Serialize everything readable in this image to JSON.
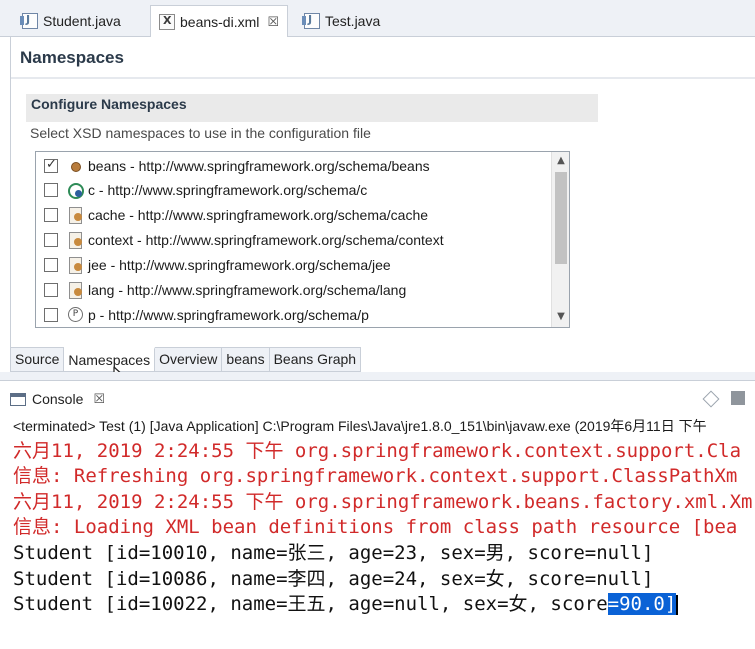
{
  "editor_tabs": [
    {
      "label": "Student.java",
      "icon": "java-file-icon"
    },
    {
      "label": "beans-di.xml",
      "icon": "xml-file-icon",
      "close": "☒"
    },
    {
      "label": "Test.java",
      "icon": "java-file-icon"
    }
  ],
  "namespaces_page": {
    "title": "Namespaces",
    "section_title": "Configure Namespaces",
    "description": "Select XSD namespaces to use in the configuration file",
    "items": [
      {
        "label": "beans - http://www.springframework.org/schema/beans",
        "checked": true,
        "icon": "bean-icon"
      },
      {
        "label": "c - http://www.springframework.org/schema/c",
        "checked": false,
        "icon": "c-namespace-icon"
      },
      {
        "label": "cache - http://www.springframework.org/schema/cache",
        "checked": false,
        "icon": "cache-namespace-icon"
      },
      {
        "label": "context - http://www.springframework.org/schema/context",
        "checked": false,
        "icon": "context-namespace-icon"
      },
      {
        "label": "jee - http://www.springframework.org/schema/jee",
        "checked": false,
        "icon": "jee-namespace-icon"
      },
      {
        "label": "lang - http://www.springframework.org/schema/lang",
        "checked": false,
        "icon": "lang-namespace-icon"
      },
      {
        "label": "p - http://www.springframework.org/schema/p",
        "checked": false,
        "icon": "p-namespace-icon"
      }
    ]
  },
  "page_tabs": [
    "Source",
    "Namespaces",
    "Overview",
    "beans",
    "Beans Graph"
  ],
  "active_page_tab": "Namespaces",
  "console": {
    "title": "Console",
    "close": "☒",
    "status": "<terminated> Test (1) [Java Application] C:\\Program Files\\Java\\jre1.8.0_151\\bin\\javaw.exe (2019年6月11日 下午",
    "lines": [
      {
        "text": "六月11, 2019 2:24:55 下午 org.springframework.context.support.Cla",
        "color": "#d12a2a"
      },
      {
        "text": "信息: Refreshing org.springframework.context.support.ClassPathXm",
        "color": "#d12a2a"
      },
      {
        "text": "六月11, 2019 2:24:55 下午 org.springframework.beans.factory.xml.Xm",
        "color": "#d12a2a"
      },
      {
        "text": "信息: Loading XML bean definitions from class path resource [bea",
        "color": "#d12a2a"
      },
      {
        "text": "Student [id=10010, name=张三, age=23, sex=男, score=null]",
        "color": "#111111"
      },
      {
        "text": "Student [id=10086, name=李四, age=24, sex=女, score=null]",
        "color": "#111111"
      },
      {
        "text": "Student [id=10022, name=王五, age=null, sex=女, score",
        "color": "#111111"
      }
    ],
    "selected_text": "=90.0]"
  },
  "colors": {
    "error_text": "#d12a2a",
    "selection": "#0a62d6",
    "tab_bar": "#eef1f6"
  }
}
